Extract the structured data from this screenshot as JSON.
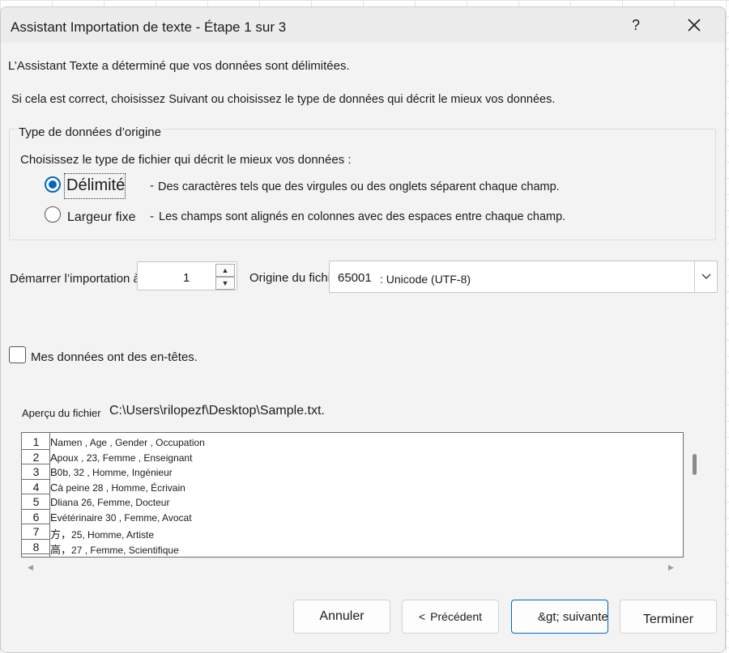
{
  "dialog": {
    "title": "Assistant Importation de texte - Étape 1 sur 3",
    "help_label": "?",
    "close_icon": "close-icon"
  },
  "intro": {
    "line1": "L’Assistant Texte a déterminé que vos données sont délimitées.",
    "line2": "Si cela est correct, choisissez Suivant ou choisissez le type de données qui décrit le mieux vos données."
  },
  "original_type": {
    "legend": "Type de données d’origine",
    "prompt": "Choisissez le type de fichier qui décrit le mieux vos données :",
    "options": [
      {
        "label": "Délimité",
        "dash": "-",
        "description": "Des caractères tels que des virgules ou des onglets séparent chaque champ.",
        "checked": true
      },
      {
        "label": "Largeur fixe",
        "dash": "-",
        "description": "Les champs sont alignés en colonnes avec des espaces entre chaque champ.",
        "checked": false
      }
    ]
  },
  "import_start": {
    "label": "Démarrer l’importation à tow :",
    "value": "1"
  },
  "file_origin": {
    "label": "Origine du fichier",
    "code": "65001",
    "value": ": Unicode (UTF-8)"
  },
  "headers_checkbox": {
    "label": "Mes données ont des en-têtes.",
    "checked": false
  },
  "preview": {
    "label": "Aperçu du fichier",
    "path": "C:\\Users\\rilopezf\\Desktop\\Sample.txt.",
    "rows": [
      {
        "num": "1",
        "first": "N",
        "text": "amen , Age , Gender , Occupation"
      },
      {
        "num": "2",
        "first": "A",
        "text": "poux , 23, Femme , Enseignant"
      },
      {
        "num": "3",
        "first": "B",
        "text": "0b, 32 , Homme, Ingénieur"
      },
      {
        "num": "4",
        "first": "C",
        "text": "à peine 28 , Homme, Écrivain"
      },
      {
        "num": "5",
        "first": "D",
        "text": "liana 26, Femme, Docteur"
      },
      {
        "num": "6",
        "first": "E",
        "text": "vétérinaire 30 , Femme, Avocat"
      },
      {
        "num": "7",
        "first": "方，",
        "text": "25, Homme, Artiste"
      },
      {
        "num": "8",
        "first": "高，",
        "text": "27 , Femme, Scientifique"
      }
    ]
  },
  "buttons": {
    "cancel": "Annuler",
    "back": "Précédent",
    "back_chevron": "<",
    "next": "&gt; suivante",
    "finish": "Terminer"
  }
}
